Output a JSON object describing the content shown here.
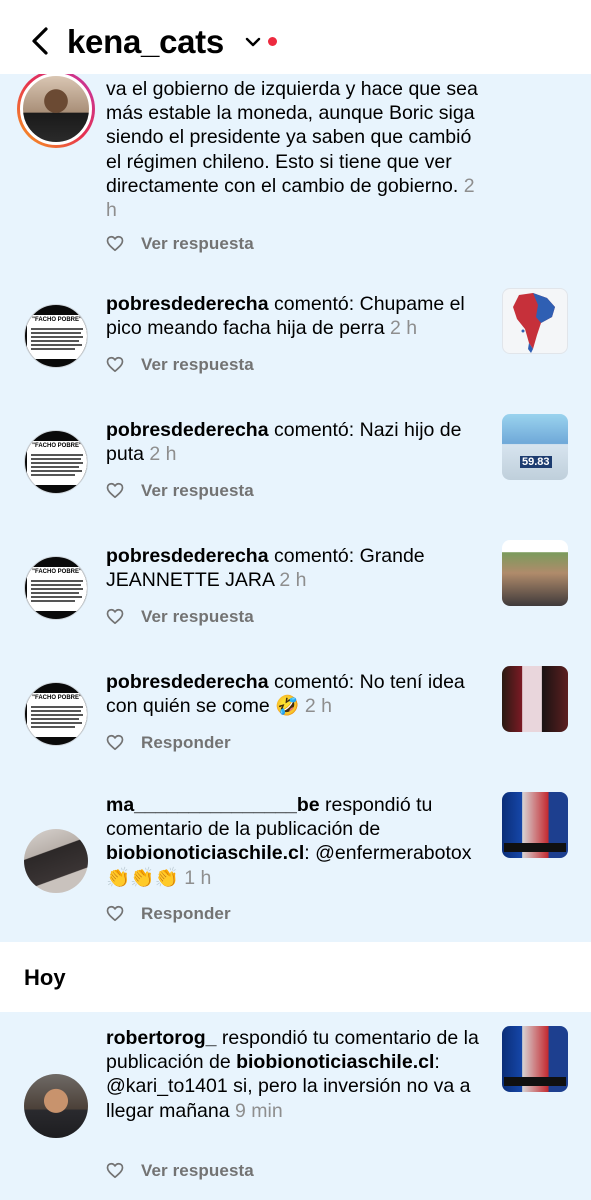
{
  "header": {
    "username": "kena_cats"
  },
  "section_today": "Hoy",
  "notifications": [
    {
      "text_plain": "va el gobierno de izquierda y hace que sea más estable la moneda, aunque Boric siga siendo el presidente ya saben que cambió el régimen chileno. Esto si tiene que ver directamente con el cambio de gobierno.",
      "time": "2 h",
      "action": "Ver respuesta"
    },
    {
      "user": "pobresdederecha",
      "verb": " comentó: ",
      "body": "Chupame el pico meando facha hija de perra",
      "time": "2 h",
      "action": "Ver respuesta"
    },
    {
      "user": "pobresdederecha",
      "verb": " comentó: ",
      "body": "Nazi hijo de puta",
      "time": "2 h",
      "action": "Ver respuesta",
      "thumb_number": "59.83"
    },
    {
      "user": "pobresdederecha",
      "verb": " comentó: ",
      "body": "Grande JEANNETTE JARA",
      "time": "2 h",
      "action": "Ver respuesta"
    },
    {
      "user": "pobresdederecha",
      "verb": " comentó: ",
      "body": "No tení idea con quién se come 🤣",
      "time": "2 h",
      "action": "Responder"
    },
    {
      "user": "ma_______________be",
      "verb": " respondió tu comentario de la publicación de ",
      "target": "biobionoticiaschile.cl",
      "body": ": @enfermerabotox 👏👏👏",
      "time": "1 h",
      "action": "Responder"
    },
    {
      "user": "robertorog_",
      "verb": " respondió tu comentario de la publicación de ",
      "target": "biobionoticiaschile.cl",
      "body": ": @kari_to1401 si, pero la inversión no va a llegar mañana",
      "time": "9 min",
      "action": "Ver respuesta"
    }
  ],
  "facho_title": "\"FACHO POBRE\"",
  "colors": {
    "band": "#e8f4fd",
    "notification_dot": "#ed2a3f",
    "muted": "#737373",
    "time": "#8e8e8e"
  }
}
